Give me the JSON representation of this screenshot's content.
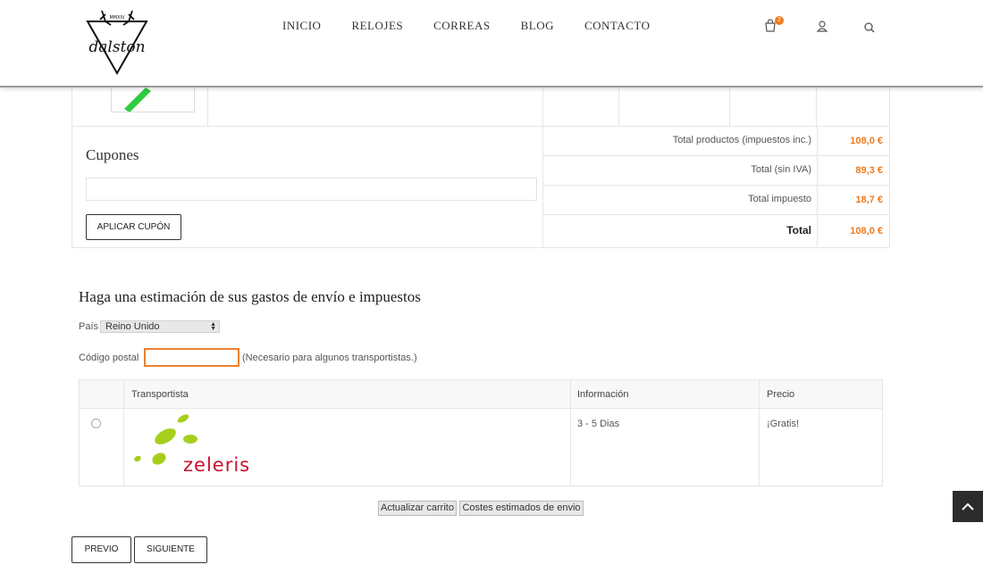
{
  "header": {
    "nav": [
      "INICIO",
      "RELOJES",
      "CORREAS",
      "BLOG",
      "CONTACTO"
    ],
    "cart_count": "2",
    "icons": [
      "cart-icon",
      "user-icon",
      "search-icon"
    ],
    "logo": {
      "brand": "dalston",
      "mark": "MMXIV"
    }
  },
  "coupons": {
    "title": "Cupones",
    "input_value": "",
    "apply_label": "APLICAR CUPÓN"
  },
  "totals": [
    {
      "label": "Total productos (impuestos inc.)",
      "value": "108,0 €"
    },
    {
      "label": "Total (sin IVA)",
      "value": "89,3 €"
    },
    {
      "label": "Total impuesto",
      "value": "18,7 €"
    },
    {
      "label": "Total",
      "value": "108,0 €"
    }
  ],
  "shipping": {
    "title": "Haga una estimación de sus gastos de envío e impuestos",
    "country_label": "País",
    "country_value": "Reino Unido",
    "zip_label": "Código postal",
    "zip_value": "",
    "zip_note": "(Necesario para algunos transportistas.)",
    "table": {
      "headers": [
        "Transportista",
        "Información",
        "Precio"
      ],
      "rows": [
        {
          "carrier_logo_text": "zeleris",
          "info": "3 - 5 Dias",
          "price": "¡Gratis!"
        }
      ]
    },
    "update_cart_label": "Actualizar carrito",
    "estimate_label": "Costes estimados de envio"
  },
  "footer_nav": {
    "prev_label": "PREVIO",
    "next_label": "SIGUIENTE"
  },
  "colors": {
    "accent": "#f07a1a",
    "zeleris_green": "#a6cf1d",
    "zeleris_red": "#c8102e",
    "scroll_top_bg": "#2b2b2b"
  }
}
